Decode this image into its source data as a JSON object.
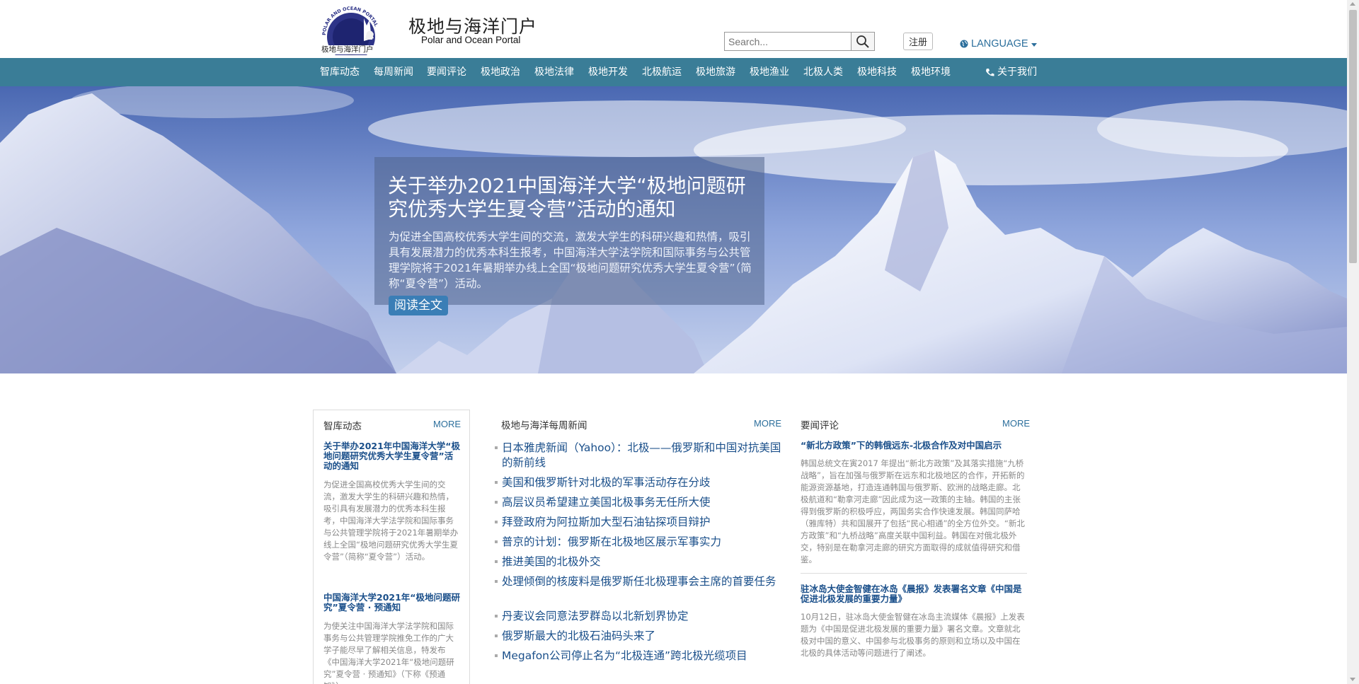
{
  "header": {
    "logo_text": "POLAR AND OCEAN PORTAL",
    "logo_caption": "极地与海洋门户",
    "title": "极地与海洋门户",
    "subtitle": "Polar and Ocean Portal",
    "search_placeholder": "Search...",
    "register_label": "注册",
    "language_label": "LANGUAGE"
  },
  "nav": {
    "items": [
      "智库动态",
      "每周新闻",
      "要闻评论",
      "极地政治",
      "极地法律",
      "极地开发",
      "北极航运",
      "极地旅游",
      "极地渔业",
      "北极人类",
      "极地科技",
      "极地环境"
    ],
    "about_label": "关于我们"
  },
  "hero": {
    "title": "关于举办2021中国海洋大学“极地问题研究优秀大学生夏令营”活动的通知",
    "desc": "为促进全国高校优秀大学生间的交流，激发大学生的科研兴趣和热情，吸引具有发展潜力的优秀本科生报考，中国海洋大学法学院和国际事务与公共管理学院将于2021年暑期举办线上全国“极地问题研究优秀大学生夏令营”（简称“夏令营”）活动。",
    "button_label": "阅读全文"
  },
  "col1": {
    "heading": "智库动态",
    "more": "MORE",
    "articles": [
      {
        "title": "关于举办2021年中国海洋大学“极地问题研究优秀大学生夏令营”活动的通知",
        "body": "为促进全国高校优秀大学生间的交流，激发大学生的科研兴趣和热情，吸引具有发展潜力的优秀本科生报考，中国海洋大学法学院和国际事务与公共管理学院将于2021年暑期举办线上全国“极地问题研究优秀大学生夏令营”（简称“夏令营”）活动。"
      },
      {
        "title": "中国海洋大学2021年“极地问题研究”夏令营 · 预通知",
        "body": "为使关注中国海洋大学法学院和国际事务与公共管理学院推免工作的广大学子能尽早了解相关信息，特发布《中国海洋大学2021年“极地问题研究”夏令营 · 预通知》（下称《预通知》）"
      }
    ]
  },
  "col2": {
    "heading": "极地与海洋每周新闻",
    "more": "MORE",
    "items": [
      "日本雅虎新闻（Yahoo）：北极——俄罗斯和中国对抗美国的新前线",
      "美国和俄罗斯针对北极的军事活动存在分歧",
      "高层议员希望建立美国北极事务无任所大使",
      "拜登政府为阿拉斯加大型石油钻探项目辩护",
      "普京的计划：俄罗斯在北极地区展示军事实力",
      "推进美国的北极外交",
      "处理倾倒的核废料是俄罗斯任北极理事会主席的首要任务",
      "丹麦议会同意法罗群岛以北新划界协定",
      "俄罗斯最大的北极石油码头来了",
      "Megafon公司停止名为“北极连通”跨北极光缆项目"
    ]
  },
  "col3": {
    "heading": "要闻评论",
    "more": "MORE",
    "articles": [
      {
        "title": "“新北方政策”下的韩俄远东-北极合作及对中国启示",
        "body": "韩国总统文在寅2017 年提出“新北方政策”及其落实措施“九桥战略”，旨在加强与俄罗斯在远东和北极地区的合作，开拓新的能源资源基地，打造连通韩国与俄罗斯、欧洲的战略走廊。北极航道和“勒拿河走廊”因此成为这一政策的主轴。韩国的主张得到俄罗斯的积极呼应，两国务实合作快速发展。韩国同萨哈（雅库特）共和国展开了包括“民心相通”的全方位外交。“新北方政策”和“九桥战略”高度关联中国利益。韩国在对俄北极外交，特别是在勒拿河走廊的研究方面取得的成就值得研究和借鉴。"
      },
      {
        "title": "驻冰岛大使金智健在冰岛《晨报》发表署名文章《中国是促进北极发展的重要力量》",
        "body": "10月12日，驻冰岛大使金智健在冰岛主流媒体《晨报》上发表题为《中国是促进北极发展的重要力量》署名文章。文章就北极对中国的意义、中国参与北极事务的原则和立场以及中国在北极的具体活动等问题进行了阐述。"
      }
    ]
  }
}
